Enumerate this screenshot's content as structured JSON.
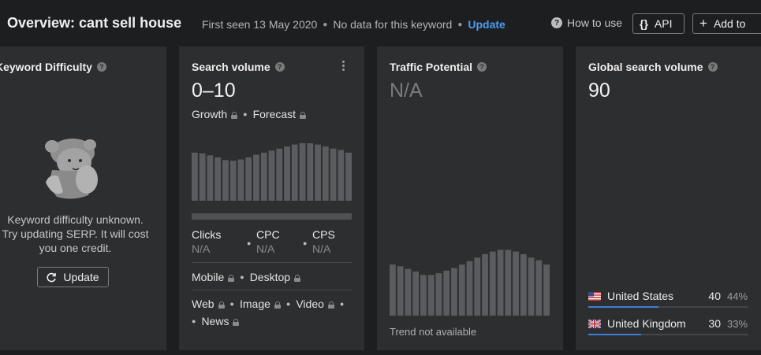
{
  "header": {
    "title": "Overview: cant sell house",
    "first_seen": "First seen 13 May 2020",
    "no_data": "No data for this keyword",
    "update_link": "Update",
    "how_to_use": "How to use",
    "api_label": "API",
    "add_to_label": "Add to"
  },
  "keyword_difficulty": {
    "title": "Keyword Difficulty",
    "message_line1": "Keyword difficulty unknown.",
    "message_line2": "Try updating SERP. It will cost",
    "message_line3": "you one credit.",
    "update_button": "Update"
  },
  "search_volume": {
    "title": "Search volume",
    "value": "0–10",
    "growth_label": "Growth",
    "forecast_label": "Forecast",
    "bar_levels": [
      0.71,
      0.7,
      0.67,
      0.64,
      0.6,
      0.59,
      0.61,
      0.64,
      0.68,
      0.71,
      0.74,
      0.77,
      0.8,
      0.83,
      0.85,
      0.85,
      0.83,
      0.8,
      0.77,
      0.75,
      0.71
    ],
    "metrics": [
      {
        "label": "Clicks",
        "value": "N/A"
      },
      {
        "label": "CPC",
        "value": "N/A"
      },
      {
        "label": "CPS",
        "value": "N/A"
      }
    ],
    "device_mobile": "Mobile",
    "device_desktop": "Desktop",
    "serp_web": "Web",
    "serp_image": "Image",
    "serp_video": "Video",
    "serp_news": "News"
  },
  "traffic_potential": {
    "title": "Traffic Potential",
    "value": "N/A",
    "bar_levels": [
      0.59,
      0.57,
      0.54,
      0.51,
      0.47,
      0.47,
      0.49,
      0.52,
      0.55,
      0.59,
      0.63,
      0.67,
      0.71,
      0.74,
      0.76,
      0.76,
      0.74,
      0.71,
      0.67,
      0.64,
      0.59
    ],
    "note": "Trend not available"
  },
  "global_volume": {
    "title": "Global search volume",
    "value": "90",
    "countries": [
      {
        "name": "United States",
        "volume": "40",
        "percent": "44%",
        "share": 0.44
      },
      {
        "name": "United Kingdom",
        "volume": "30",
        "percent": "33%",
        "share": 0.33
      }
    ]
  }
}
